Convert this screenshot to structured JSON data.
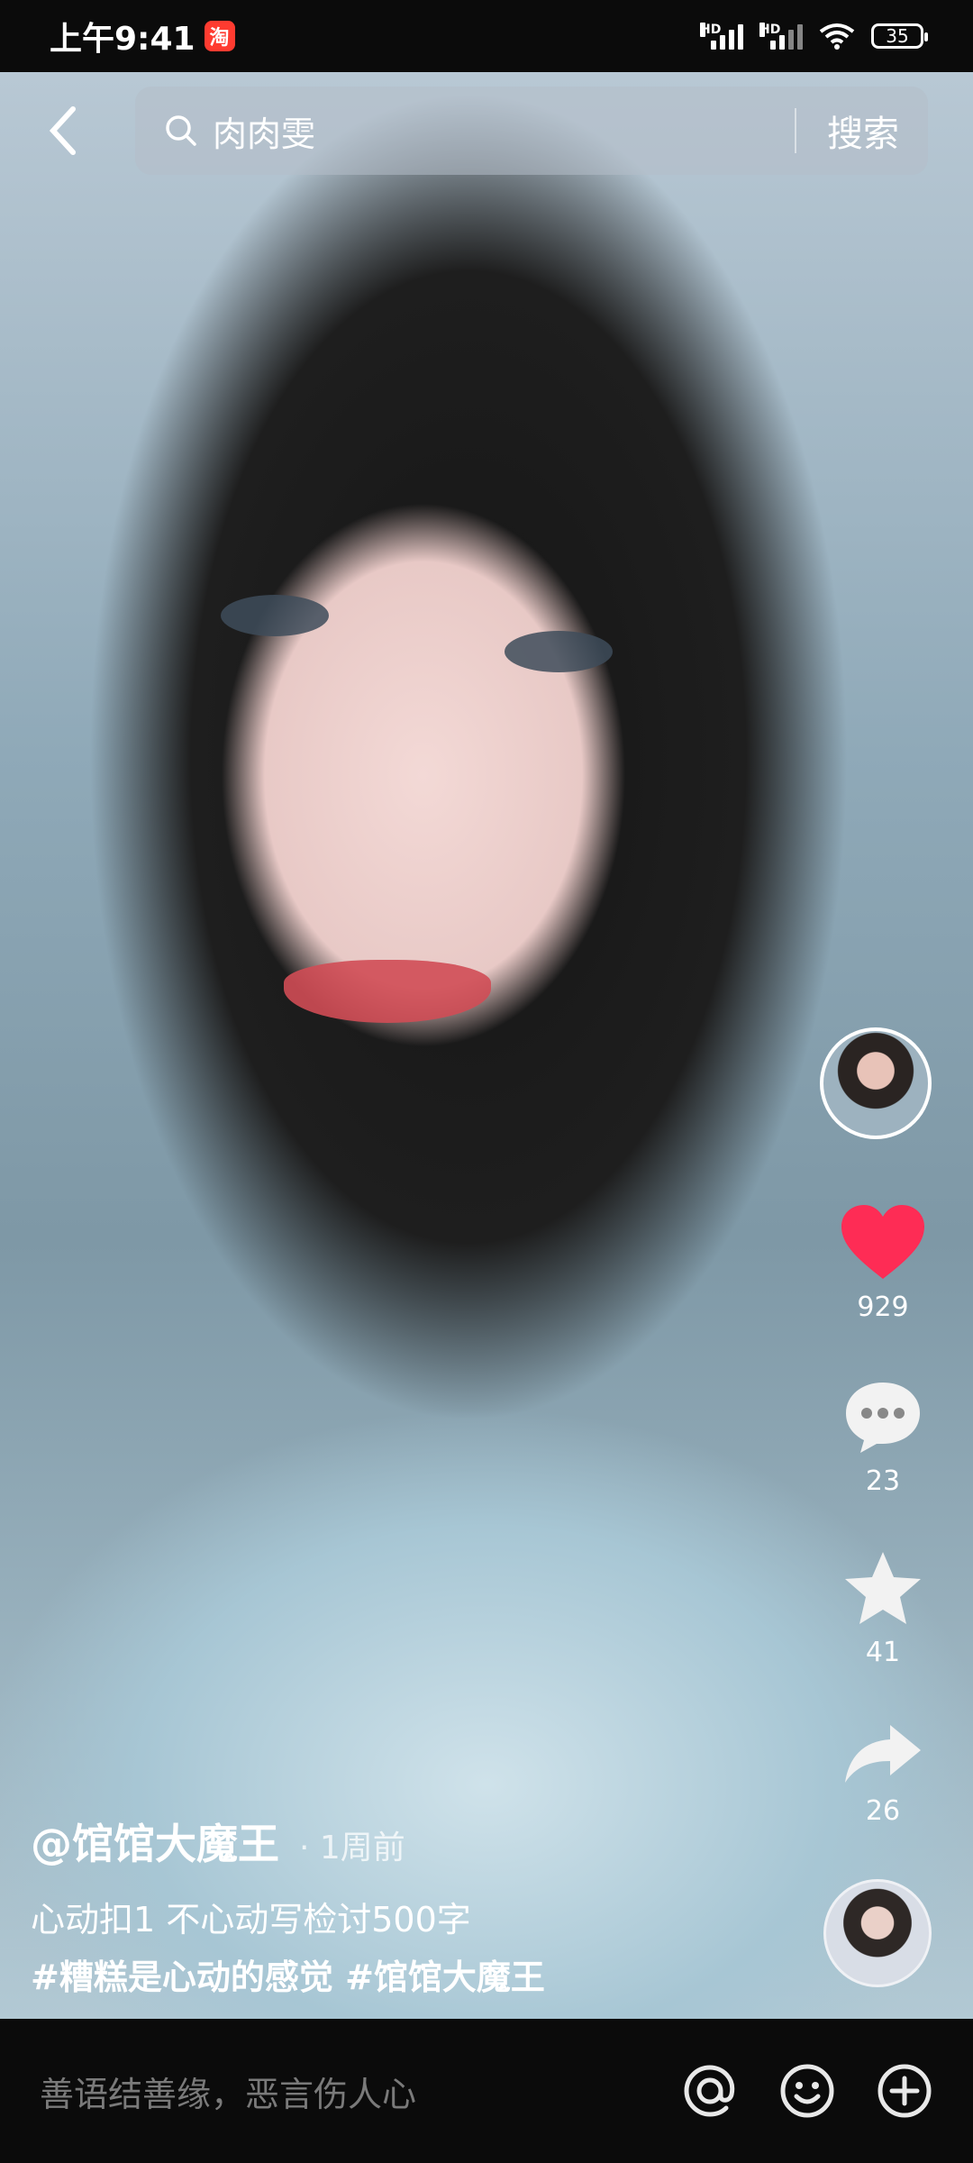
{
  "status_bar": {
    "time": "上午9:41",
    "app_icon": "淘",
    "hd1": "HD",
    "hd2": "HD",
    "battery": "35"
  },
  "search": {
    "query": "肉肉雯",
    "button_label": "搜索"
  },
  "actions": {
    "likes": "929",
    "comments": "23",
    "favorites": "41",
    "shares": "26",
    "like_color": "#fe2c55"
  },
  "post": {
    "author": "@馆馆大魔王",
    "time": "· 1周前",
    "description": "心动扣1 不心动写检讨500字",
    "hashtags": "#糟糕是心动的感觉 #馆馆大魔王"
  },
  "comment_bar": {
    "placeholder": "善语结善缘，恶言伤人心"
  }
}
